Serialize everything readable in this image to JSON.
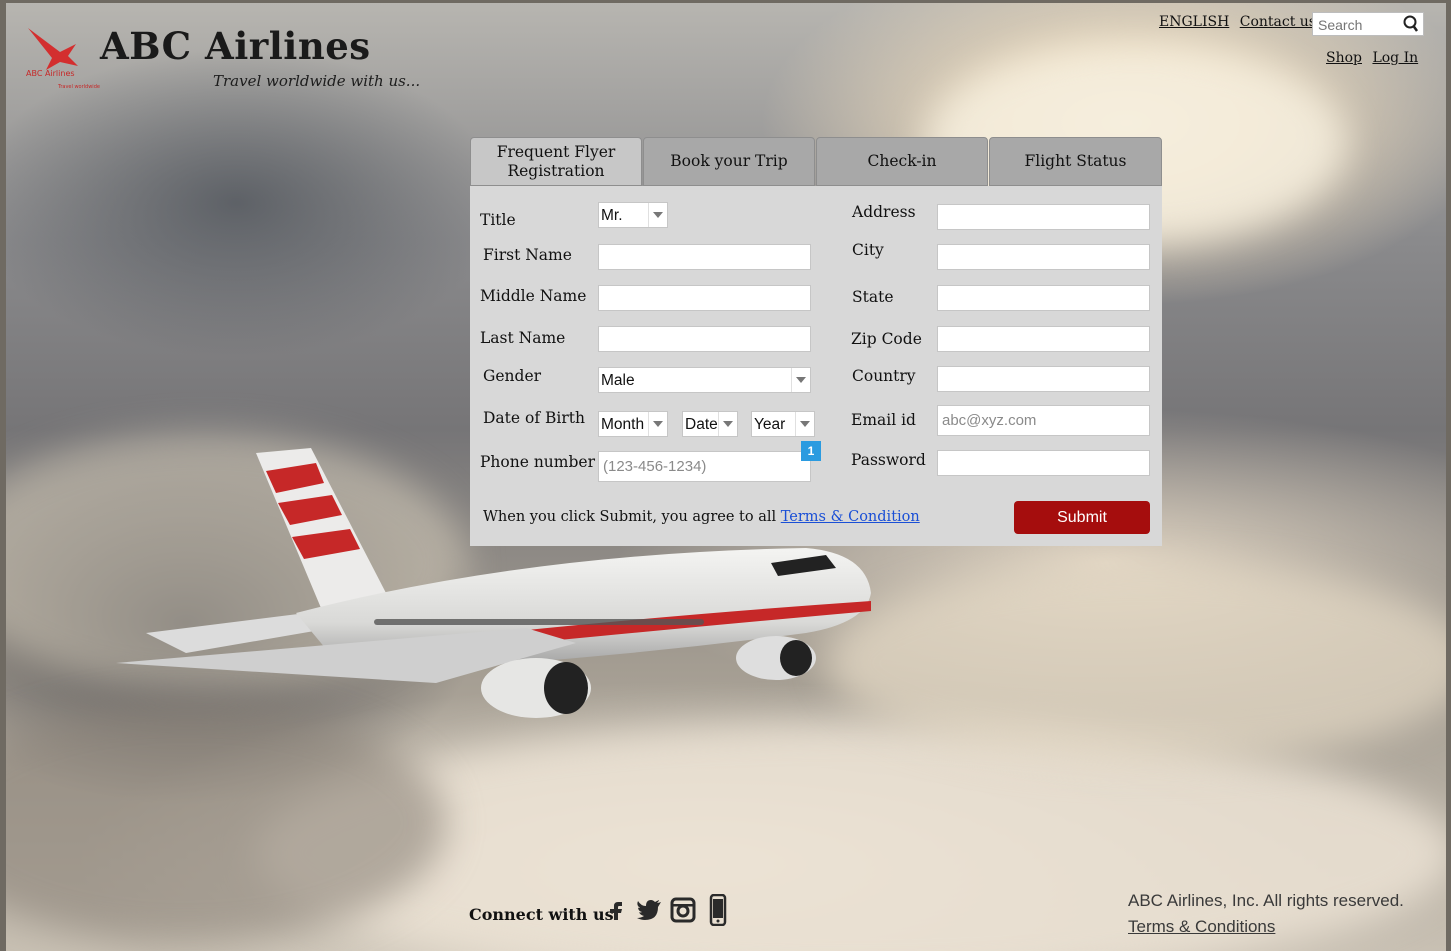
{
  "header": {
    "brand": "ABC Airlines",
    "tagline": "Travel worldwide with us...",
    "logo_text": "ABC Airlines",
    "links": {
      "language": "ENGLISH",
      "contact": "Contact us",
      "shop": "Shop",
      "login": "Log In"
    },
    "search_placeholder": "Search"
  },
  "tabs": [
    {
      "label_line1": "Frequent Flyer",
      "label_line2": "Registration",
      "active": true
    },
    {
      "label": "Book your Trip"
    },
    {
      "label": "Check-in"
    },
    {
      "label": "Flight Status"
    }
  ],
  "form": {
    "labels": {
      "title": "Title",
      "first_name": "First Name",
      "middle_name": "Middle Name",
      "last_name": "Last Name",
      "gender": "Gender",
      "dob": "Date of Birth",
      "phone": "Phone number",
      "address": "Address",
      "city": "City",
      "state": "State",
      "zip": "Zip Code",
      "country": "Country",
      "email": "Email id",
      "password": "Password"
    },
    "title_value": "Mr.",
    "gender_value": "Male",
    "dob_month": "Month",
    "dob_date": "Date",
    "dob_year": "Year",
    "phone_placeholder": "(123-456-1234)",
    "email_placeholder": "abc@xyz.com",
    "badge": "1",
    "agree_text": "When you click Submit, you agree to all ",
    "agree_link": "Terms & Condition",
    "submit": "Submit"
  },
  "footer": {
    "connect": "Connect with us",
    "social_icons": [
      "facebook-icon",
      "twitter-icon",
      "instagram-icon",
      "mobile-icon"
    ],
    "rights": "ABC Airlines, Inc. All rights reserved.",
    "terms": "Terms & Conditions"
  },
  "colors": {
    "submit": "#a50d0d",
    "link": "#1a4fd6",
    "badge": "#2b9be0"
  }
}
